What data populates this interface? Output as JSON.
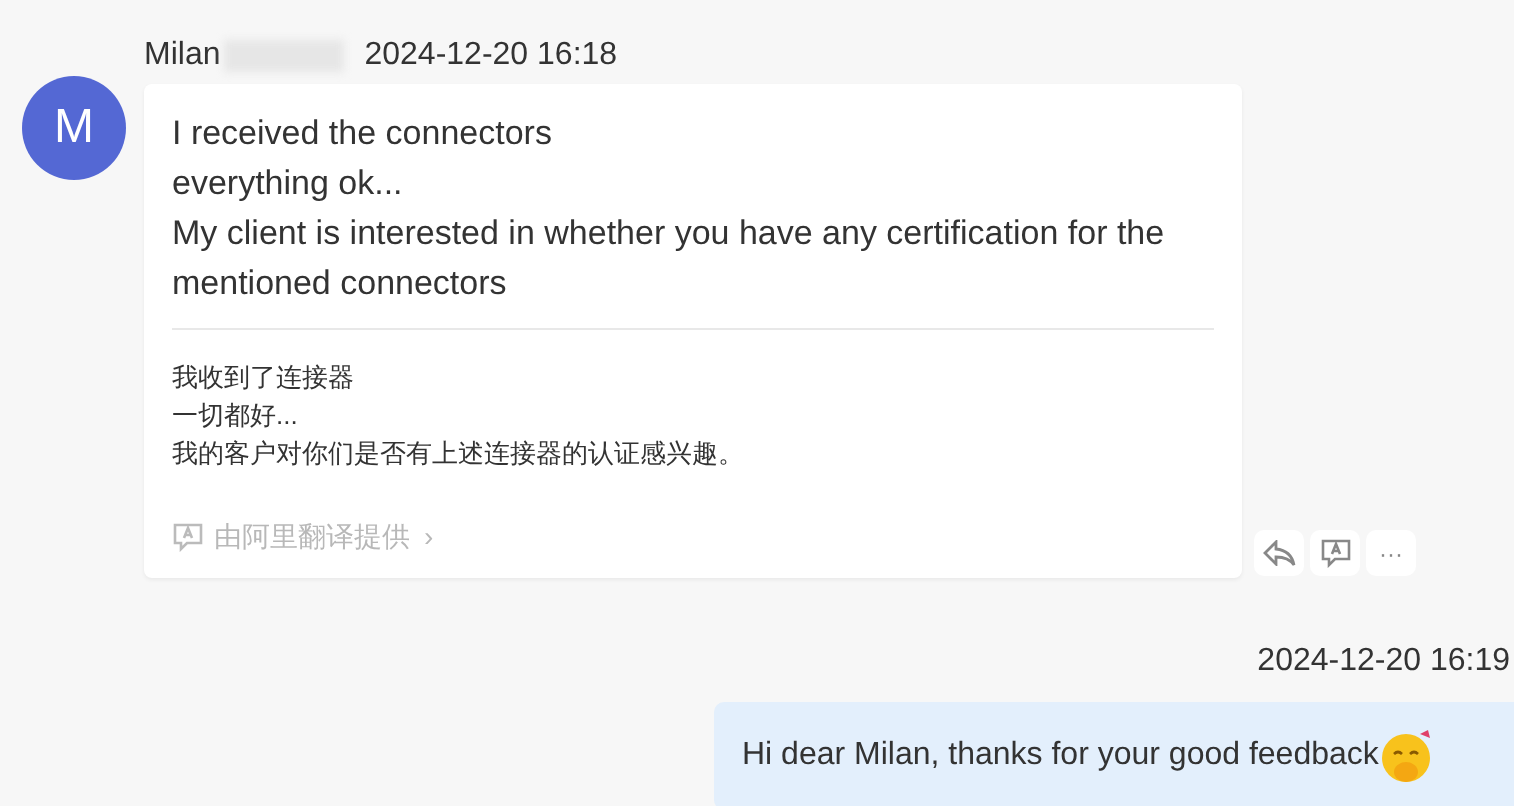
{
  "incoming": {
    "avatar_letter": "M",
    "sender": "Milan",
    "time": "2024-12-20 16:18",
    "original_lines": [
      "I received the connectors",
      "everything ok...",
      "My client is interested in whether you have any certification for the mentioned connectors"
    ],
    "translated_lines": [
      "我收到了连接器",
      "一切都好...",
      "我的客户对你们是否有上述连接器的认证感兴趣。"
    ],
    "translation_credit": "由阿里翻译提供",
    "chevron": "›",
    "more": "···"
  },
  "outgoing": {
    "time": "2024-12-20 16:19",
    "text": "Hi dear Milan, thanks for your good feedback"
  }
}
